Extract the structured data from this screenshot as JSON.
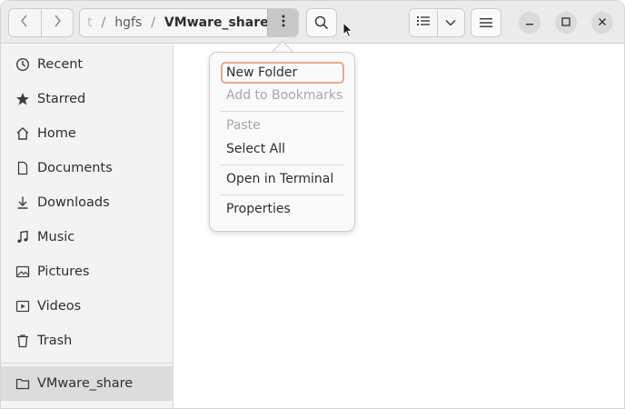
{
  "pathbar": {
    "faded_segment": "t",
    "separator": "/",
    "parent": "hgfs",
    "current": "VMware_share"
  },
  "sidebar": {
    "items": [
      {
        "label": "Recent",
        "icon": "clock-icon"
      },
      {
        "label": "Starred",
        "icon": "star-icon"
      },
      {
        "label": "Home",
        "icon": "home-icon"
      },
      {
        "label": "Documents",
        "icon": "document-icon"
      },
      {
        "label": "Downloads",
        "icon": "download-icon"
      },
      {
        "label": "Music",
        "icon": "music-icon"
      },
      {
        "label": "Pictures",
        "icon": "picture-icon"
      },
      {
        "label": "Videos",
        "icon": "video-icon"
      },
      {
        "label": "Trash",
        "icon": "trash-icon"
      }
    ],
    "mounted": {
      "label": "VMware_share",
      "icon": "folder-icon"
    }
  },
  "menu": {
    "items": [
      {
        "label": "New Folder",
        "state": "focused"
      },
      {
        "label": "Add to Bookmarks",
        "state": "disabled"
      },
      {
        "label": "Paste",
        "state": "disabled"
      },
      {
        "label": "Select All",
        "state": "enabled"
      },
      {
        "label": "Open in Terminal",
        "state": "enabled"
      },
      {
        "label": "Properties",
        "state": "enabled"
      }
    ]
  },
  "colors": {
    "focus_ring": "#e6a98c",
    "headerbar": "#ebebeb",
    "sidebar": "#f3f3f3",
    "selected_row": "#dcdcdc"
  }
}
